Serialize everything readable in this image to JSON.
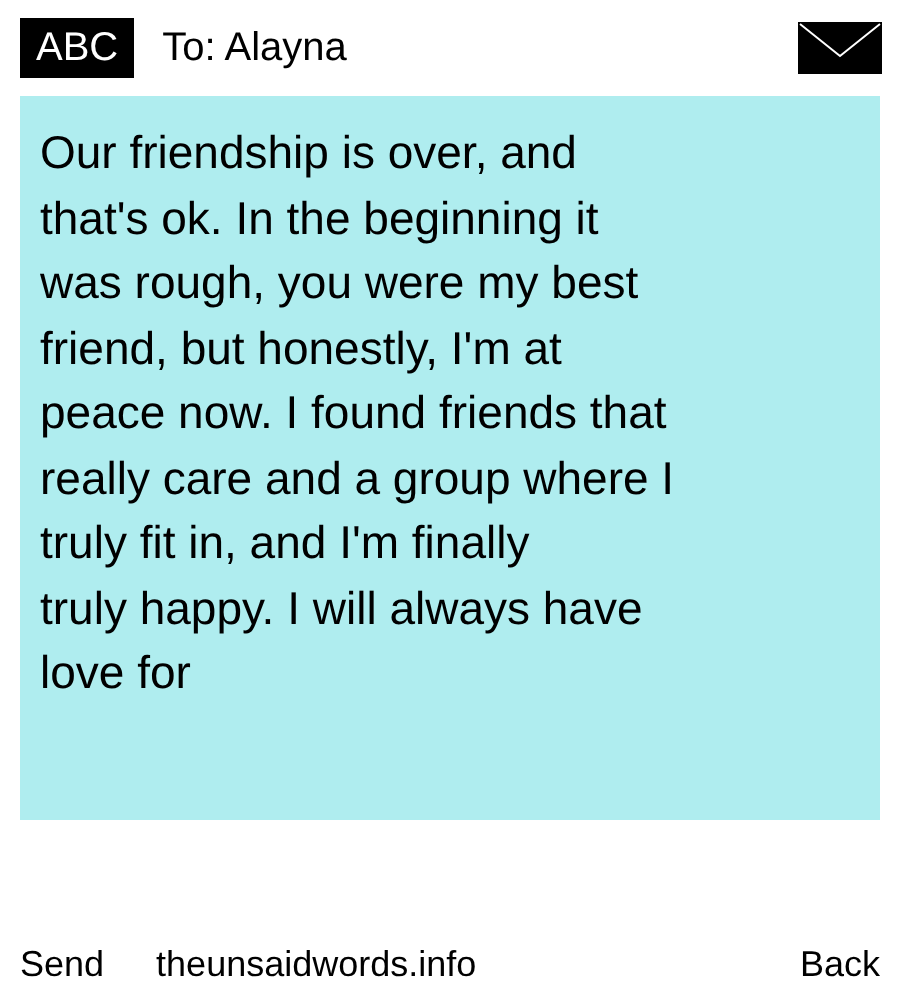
{
  "header": {
    "input_mode": "ABC",
    "recipient": "To: Alayna"
  },
  "message": {
    "text": "Our friendship is over, and\nthat's ok. In the beginning it\nwas rough, you were my best\nfriend, but honestly, I'm at\npeace now. I found friends that\nreally care and a group where I\ntruly fit in, and I'm finally\ntruly happy. I will always have\nlove for"
  },
  "footer": {
    "left": "Send",
    "center": "theunsaidwords.info",
    "right": "Back"
  }
}
